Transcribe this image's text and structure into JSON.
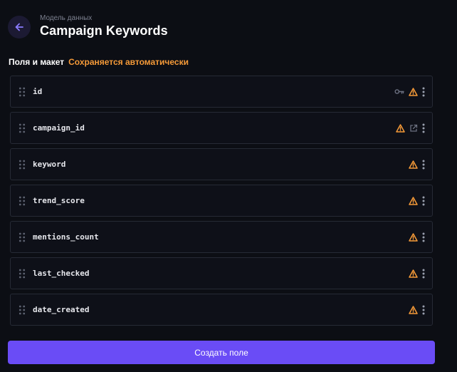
{
  "header": {
    "back_icon": "arrow-left-icon",
    "breadcrumb": "Модель данных",
    "title": "Campaign Keywords"
  },
  "section": {
    "label": "Поля и макет",
    "autosave": "Сохраняется автоматически"
  },
  "colors": {
    "accent": "#6a4cf6",
    "warning": "#f59a38",
    "background": "#0c0e14"
  },
  "fields": [
    {
      "name": "id",
      "icons": [
        "key-icon",
        "warning-icon",
        "more-vertical-icon"
      ]
    },
    {
      "name": "campaign_id",
      "icons": [
        "warning-icon",
        "external-link-icon",
        "more-vertical-icon"
      ]
    },
    {
      "name": "keyword",
      "icons": [
        "warning-icon",
        "more-vertical-icon"
      ]
    },
    {
      "name": "trend_score",
      "icons": [
        "warning-icon",
        "more-vertical-icon"
      ]
    },
    {
      "name": "mentions_count",
      "icons": [
        "warning-icon",
        "more-vertical-icon"
      ]
    },
    {
      "name": "last_checked",
      "icons": [
        "warning-icon",
        "more-vertical-icon"
      ]
    },
    {
      "name": "date_created",
      "icons": [
        "warning-icon",
        "more-vertical-icon"
      ]
    }
  ],
  "create_button": {
    "label": "Создать поле"
  }
}
